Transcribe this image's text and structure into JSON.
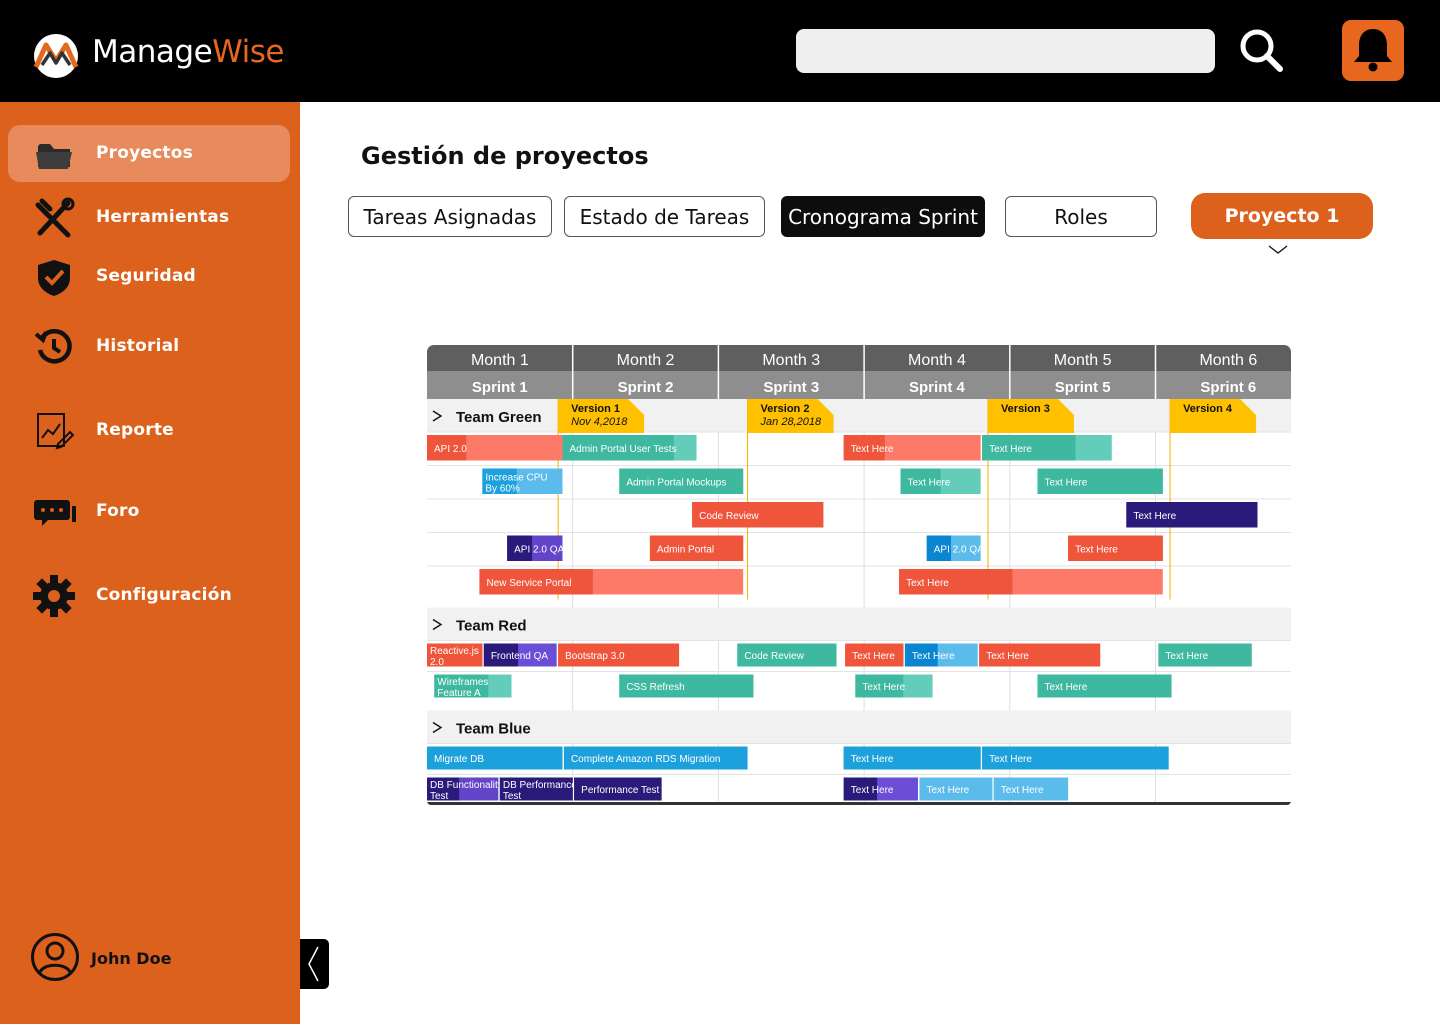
{
  "app": {
    "brand_part1": "Manage",
    "brand_part2": "Wise"
  },
  "colors": {
    "accent": "#dc611c",
    "header": "#000000",
    "active_nav": "#e78a5c"
  },
  "header": {
    "search": {
      "placeholder": "",
      "value": "",
      "icon": "search-icon"
    },
    "notifications": {
      "icon": "bell-icon"
    }
  },
  "sidebar": {
    "items": [
      {
        "label": "Proyectos",
        "icon": "folder-icon",
        "active": true
      },
      {
        "label": "Herramientas",
        "icon": "tools-icon",
        "active": false
      },
      {
        "label": "Seguridad",
        "icon": "shield-icon",
        "active": false
      },
      {
        "label": "Historial",
        "icon": "history-icon",
        "active": false
      },
      {
        "label": "Reporte",
        "icon": "report-icon",
        "active": false
      },
      {
        "label": "Foro",
        "icon": "chat-icon",
        "active": false
      },
      {
        "label": "Configuración",
        "icon": "gear-icon",
        "active": false
      }
    ],
    "user": {
      "name": "John Doe",
      "icon": "user-avatar-icon"
    }
  },
  "main": {
    "title": "Gestión de proyectos",
    "tabs": [
      {
        "label": "Tareas Asignadas",
        "active": false
      },
      {
        "label": "Estado de Tareas",
        "active": false
      },
      {
        "label": "Cronograma Sprint",
        "active": true
      },
      {
        "label": "Roles",
        "active": false
      }
    ],
    "project_selector": {
      "label": "Proyecto 1"
    }
  },
  "gantt": {
    "months": [
      "Month  1",
      "Month  2",
      "Month  3",
      "Month  4",
      "Month  5",
      "Month  6"
    ],
    "sprints": [
      "Sprint 1",
      "Sprint 2",
      "Sprint 3",
      "Sprint 4",
      "Sprint 5",
      "Sprint 6"
    ],
    "versions": [
      {
        "label": "Version 1",
        "date": "Nov 4,2018",
        "month": 1.9
      },
      {
        "label": "Version 2",
        "date": "Jan 28,2018",
        "month": 3.2
      },
      {
        "label": "Version 3",
        "date": "",
        "month": 4.85
      },
      {
        "label": "Version 4",
        "date": "",
        "month": 6.1
      }
    ],
    "teams": [
      {
        "name": "Team Green",
        "rows": [
          [
            {
              "label": "API  2.0",
              "start": 0,
              "end": 0.93,
              "color": "#ef553b",
              "light": "#fc7a67",
              "split": 0.29
            },
            {
              "label": "Admin Portal User Tests",
              "start": 0.93,
              "end": 1.85,
              "color": "#3fb8a0",
              "light": "#63cdb9",
              "split": 0.83
            },
            {
              "label": "Text Here",
              "start": 2.86,
              "end": 3.8,
              "color": "#ef553b",
              "light": "#fc7a67",
              "split": 0.3
            },
            {
              "label": "Text Here",
              "start": 3.81,
              "end": 4.7,
              "color": "#3fb8a0",
              "light": "#63cdb9",
              "split": 0.72
            }
          ],
          [
            {
              "label": "Increase CPU\nBy 60%",
              "start": 0.38,
              "end": 0.93,
              "color": "#1da1dc",
              "light": "#5bbcec",
              "split": 0.43
            },
            {
              "label": "Admin Portal Mockups",
              "start": 1.32,
              "end": 2.17,
              "color": "#3fb8a0",
              "light": "#3fb8a0",
              "split": 1
            },
            {
              "label": "Text Here",
              "start": 3.25,
              "end": 3.8,
              "color": "#3fb8a0",
              "light": "#63cdb9",
              "split": 0.5
            },
            {
              "label": "Text Here",
              "start": 4.19,
              "end": 5.05,
              "color": "#3fb8a0",
              "light": "#3fb8a0",
              "split": 1
            }
          ],
          [
            {
              "label": "Code Review",
              "start": 1.82,
              "end": 2.72,
              "color": "#ef553b",
              "light": "#ef553b",
              "split": 1
            },
            {
              "label": "Text Here",
              "start": 4.8,
              "end": 5.7,
              "color": "#2a1a7a",
              "light": "#2a1a7a",
              "split": 1
            }
          ],
          [
            {
              "label": "API  2.0 QA",
              "start": 0.55,
              "end": 0.93,
              "color": "#2a1a7a",
              "light": "#6245c9",
              "split": 0.45
            },
            {
              "label": "Admin Portal",
              "start": 1.53,
              "end": 2.17,
              "color": "#ef553b",
              "light": "#ef553b",
              "split": 1
            },
            {
              "label": "API  2.0 QA",
              "start": 3.43,
              "end": 3.8,
              "color": "#0a86d0",
              "light": "#5bbcec",
              "split": 0.45
            },
            {
              "label": "Text Here",
              "start": 4.4,
              "end": 5.05,
              "color": "#ef553b",
              "light": "#ef553b",
              "split": 1
            }
          ],
          [
            {
              "label": "New Service Portal",
              "start": 0.36,
              "end": 2.17,
              "color": "#ef553b",
              "light": "#fc7a67",
              "split": 0.43
            },
            {
              "label": "Text Here",
              "start": 3.24,
              "end": 5.05,
              "color": "#ef553b",
              "light": "#fc7a67",
              "split": 0.43
            }
          ]
        ]
      },
      {
        "name": "Team Red",
        "rows": [
          [
            {
              "label": "Reactive.js\n2.0",
              "start": 0,
              "end": 0.38,
              "color": "#ef553b",
              "light": "#ef553b",
              "split": 1
            },
            {
              "label": "Frontend QA",
              "start": 0.39,
              "end": 0.89,
              "color": "#2a1a7a",
              "light": "#6a4ed6",
              "split": 0.47
            },
            {
              "label": "Bootstrap 3.0",
              "start": 0.9,
              "end": 1.73,
              "color": "#ef553b",
              "light": "#ef553b",
              "split": 1
            },
            {
              "label": "Code Review",
              "start": 2.13,
              "end": 2.81,
              "color": "#3fb8a0",
              "light": "#3fb8a0",
              "split": 1
            },
            {
              "label": "Text Here",
              "start": 2.87,
              "end": 3.27,
              "color": "#ef553b",
              "light": "#ef553b",
              "split": 1
            },
            {
              "label": "Text Here",
              "start": 3.28,
              "end": 3.78,
              "color": "#0a86d0",
              "light": "#5bbcec",
              "split": 0.45
            },
            {
              "label": "Text Here",
              "start": 3.79,
              "end": 4.62,
              "color": "#ef553b",
              "light": "#ef553b",
              "split": 1
            },
            {
              "label": "Text Here",
              "start": 5.02,
              "end": 5.66,
              "color": "#3fb8a0",
              "light": "#3fb8a0",
              "split": 1
            }
          ],
          [
            {
              "label": "Wireframes\nFeature A",
              "start": 0.05,
              "end": 0.58,
              "color": "#3fb8a0",
              "light": "#63cdb9",
              "split": 0.7
            },
            {
              "label": "CSS Refresh",
              "start": 1.32,
              "end": 2.24,
              "color": "#3fb8a0",
              "light": "#3fb8a0",
              "split": 1
            },
            {
              "label": "Text Here",
              "start": 2.94,
              "end": 3.47,
              "color": "#3fb8a0",
              "light": "#63cdb9",
              "split": 0.62
            },
            {
              "label": "Text Here",
              "start": 4.19,
              "end": 5.11,
              "color": "#3fb8a0",
              "light": "#3fb8a0",
              "split": 1
            }
          ]
        ]
      },
      {
        "name": "Team Blue",
        "rows": [
          [
            {
              "label": "Migrate DB",
              "start": 0,
              "end": 0.93,
              "color": "#1da1dc",
              "light": "#1da1dc",
              "split": 1
            },
            {
              "label": "Complete Amazon RDS Migration",
              "start": 0.94,
              "end": 2.2,
              "color": "#1da1dc",
              "light": "#1da1dc",
              "split": 1
            },
            {
              "label": "Text Here",
              "start": 2.86,
              "end": 3.8,
              "color": "#1da1dc",
              "light": "#1da1dc",
              "split": 1
            },
            {
              "label": "Text Here",
              "start": 3.81,
              "end": 5.09,
              "color": "#1da1dc",
              "light": "#1da1dc",
              "split": 1
            }
          ],
          [
            {
              "label": "DB Functionality\nTest",
              "start": 0,
              "end": 0.49,
              "color": "#2a1a7a",
              "light": "#6245c9",
              "split": 0.45
            },
            {
              "label": "DB Performance\nTest",
              "start": 0.5,
              "end": 1.0,
              "color": "#2a1a7a",
              "light": "#2a1a7a",
              "split": 1
            },
            {
              "label": "Performance Test",
              "start": 1.01,
              "end": 1.61,
              "color": "#2a1a7a",
              "light": "#2a1a7a",
              "split": 1
            },
            {
              "label": "Text Here",
              "start": 2.86,
              "end": 3.37,
              "color": "#2a1a7a",
              "light": "#6a4ed6",
              "split": 0.45
            },
            {
              "label": "Text Here",
              "start": 3.38,
              "end": 3.88,
              "color": "#5bbcec",
              "light": "#5bbcec",
              "split": 1
            },
            {
              "label": "Text Here",
              "start": 3.89,
              "end": 4.4,
              "color": "#5bbcec",
              "light": "#5bbcec",
              "split": 1
            }
          ]
        ]
      }
    ]
  }
}
